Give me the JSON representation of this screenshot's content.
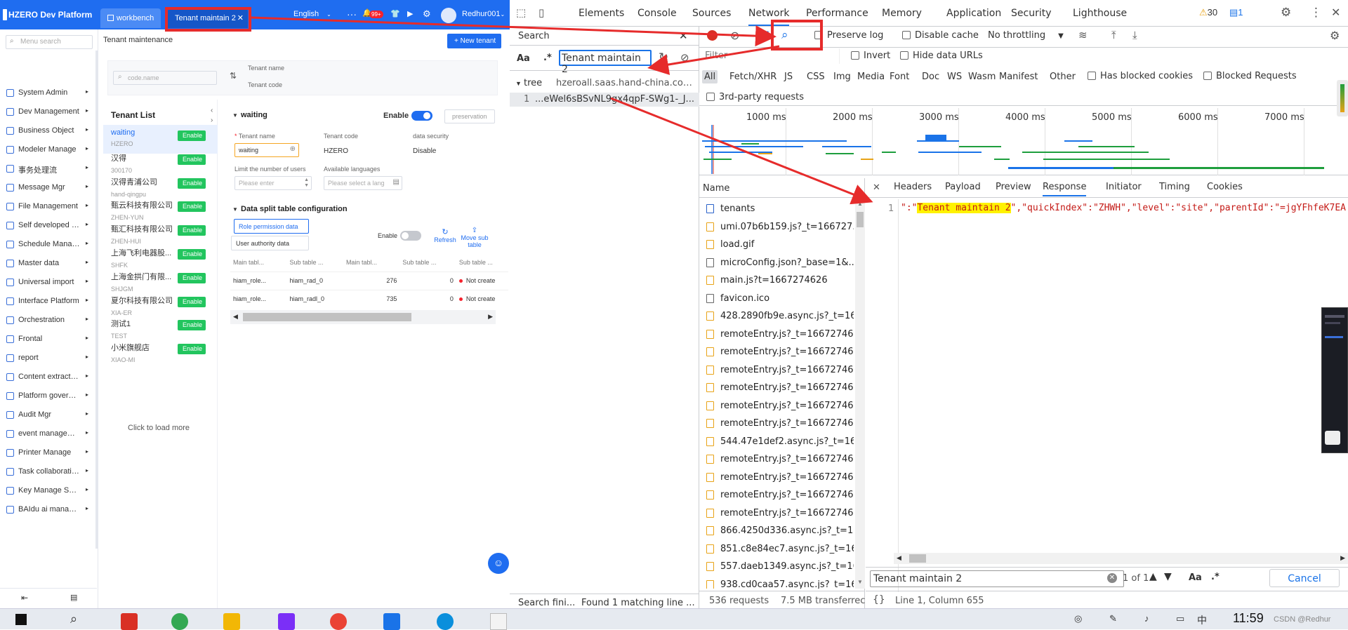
{
  "app": {
    "logo": "HZERO Dev Platform",
    "tabs": [
      {
        "label": "workbench"
      },
      {
        "label": "Tenant maintain 2"
      }
    ],
    "language": "English",
    "more": "···",
    "notif_count": "99+",
    "user": "Redhur001"
  },
  "sidebar": {
    "search_placeholder": "Menu search",
    "items": [
      "System Admin",
      "Dev Management",
      "Business Object",
      "Modeler Manage",
      "事务处理流",
      "Message Mgr",
      "File Management",
      "Self developed w...",
      "Schedule Manag...",
      "Master data",
      "Universal import",
      "Interface Platform",
      "Orchestration",
      "Frontal",
      "report",
      "Content extraction",
      "Platform governa...",
      "Audit Mgr",
      "event manageme...",
      "Printer Manage",
      "Task collaboration",
      "Key Manage Syst...",
      "BAIdu ai manage..."
    ]
  },
  "page": {
    "breadcrumb": "Tenant maintenance",
    "new_button": "+ New tenant",
    "filter": {
      "code_placeholder": "code.name",
      "sort_name": "Tenant name",
      "sort_code": "Tenant code"
    }
  },
  "tenant_list": {
    "title": "Tenant List",
    "items": [
      {
        "name": "waiting",
        "code": "HZERO",
        "status": "Enable"
      },
      {
        "name": "汉得",
        "code": "300170",
        "status": "Enable"
      },
      {
        "name": "汉得青浦公司",
        "code": "hand-qingpu",
        "status": "Enable"
      },
      {
        "name": "甄云科技有限公司",
        "code": "ZHEN-YUN",
        "status": "Enable"
      },
      {
        "name": "甄汇科技有限公司",
        "code": "ZHEN-HUI",
        "status": "Enable"
      },
      {
        "name": "上海飞利电器股...",
        "code": "SHFK",
        "status": "Enable"
      },
      {
        "name": "上海金拱门有限...",
        "code": "SHJGM",
        "status": "Enable"
      },
      {
        "name": "夏尔科技有限公司",
        "code": "XIA-ER",
        "status": "Enable"
      },
      {
        "name": "测试1",
        "code": "TEST",
        "status": "Enable"
      },
      {
        "name": "小米旗舰店",
        "code": "XIAO-MI",
        "status": "Enable"
      }
    ],
    "load_more": "Click to load more"
  },
  "detail": {
    "section_title": "waiting",
    "enable_label": "Enable",
    "preservation": "preservation",
    "labels": {
      "tenant_name": "Tenant name",
      "tenant_code": "Tenant code",
      "data_security": "data security",
      "limit_users": "Limit the number of users",
      "languages": "Available languages"
    },
    "values": {
      "tenant_name": "waiting",
      "tenant_code": "HZERO",
      "data_security": "Disable",
      "limit_placeholder": "Please enter",
      "lang_placeholder": "Please select a lang"
    },
    "split_title": "Data split table configuration",
    "tabs": [
      "Role permission data",
      "User authority data"
    ],
    "table_enable": "Enable",
    "refresh": "Refresh",
    "move_sub": "Move sub table",
    "columns": [
      "Main tabl...",
      "Sub table ...",
      "Main tabl...",
      "Sub table ...",
      "Sub table ..."
    ],
    "rows": [
      [
        "hiam_role...",
        "hiam_rad_0",
        "276",
        "0",
        "Not create"
      ],
      [
        "hiam_role...",
        "hiam_radl_0",
        "735",
        "0",
        "Not create"
      ]
    ]
  },
  "devtools": {
    "tabs": [
      "Elements",
      "Console",
      "Sources",
      "Network",
      "Performance",
      "Memory",
      "Application",
      "Security",
      "Lighthouse"
    ],
    "warnings": "30",
    "issues": "1",
    "search": {
      "title": "Search",
      "aa": "Aa",
      "regex": ".*",
      "query": "Tenant maintain 2",
      "tree_label": "tree",
      "tree_host": "hzeroall.saas.hand-china.com...",
      "result_line": "1",
      "result_text": "...eWel6sBSvNL9gx4qpF-SWg1-_J...",
      "footer_left": "Search fini...",
      "footer_right": "Found 1 matching line ..."
    },
    "toolbar": {
      "preserve_log": "Preserve log",
      "disable_cache": "Disable cache",
      "throttling": "No throttling"
    },
    "filter": {
      "placeholder": "Filter",
      "invert": "Invert",
      "hide_data_urls": "Hide data URLs"
    },
    "types": [
      "All",
      "Fetch/XHR",
      "JS",
      "CSS",
      "Img",
      "Media",
      "Font",
      "Doc",
      "WS",
      "Wasm",
      "Manifest",
      "Other"
    ],
    "blocked_cookies": "Has blocked cookies",
    "blocked_requests": "Blocked Requests",
    "third_party": "3rd-party requests",
    "timeline_ticks": [
      "1000 ms",
      "2000 ms",
      "3000 ms",
      "4000 ms",
      "5000 ms",
      "6000 ms",
      "7000 ms"
    ],
    "name_header": "Name",
    "requests": [
      {
        "name": "tenants",
        "kind": "doc"
      },
      {
        "name": "umi.07b6b159.js?_t=166727...",
        "kind": "js"
      },
      {
        "name": "load.gif",
        "kind": "img"
      },
      {
        "name": "microConfig.json?_base=1&...",
        "kind": "plain"
      },
      {
        "name": "main.js?t=1667274626",
        "kind": "js"
      },
      {
        "name": "favicon.ico",
        "kind": "plain"
      },
      {
        "name": "428.2890fb9e.async.js?_t=16...",
        "kind": "js"
      },
      {
        "name": "remoteEntry.js?_t=16672746...",
        "kind": "js"
      },
      {
        "name": "remoteEntry.js?_t=16672746...",
        "kind": "js"
      },
      {
        "name": "remoteEntry.js?_t=16672746...",
        "kind": "js"
      },
      {
        "name": "remoteEntry.js?_t=16672746...",
        "kind": "js"
      },
      {
        "name": "remoteEntry.js?_t=16672746...",
        "kind": "js"
      },
      {
        "name": "remoteEntry.js?_t=16672746...",
        "kind": "js"
      },
      {
        "name": "544.47e1def2.async.js?_t=16...",
        "kind": "js"
      },
      {
        "name": "remoteEntry.js?_t=16672746...",
        "kind": "js"
      },
      {
        "name": "remoteEntry.js?_t=16672746...",
        "kind": "js"
      },
      {
        "name": "remoteEntry.js?_t=16672746...",
        "kind": "js"
      },
      {
        "name": "remoteEntry.js?_t=16672746...",
        "kind": "js"
      },
      {
        "name": "866.4250d336.async.js?_t=16...",
        "kind": "js"
      },
      {
        "name": "851.c8e84ec7.async.js?_t=16...",
        "kind": "js"
      },
      {
        "name": "557.daeb1349.async.js?_t=16...",
        "kind": "js"
      },
      {
        "name": "938.cd0caa57.async.js?_t=16...",
        "kind": "js"
      }
    ],
    "detail_tabs": [
      "Headers",
      "Payload",
      "Preview",
      "Response",
      "Initiator",
      "Timing",
      "Cookies"
    ],
    "response": {
      "line_no": "1",
      "pre": "\":\"",
      "highlight": "Tenant maintain 2",
      "post": "\",\"quickIndex\":\"ZHWH\",\"level\":\"site\",\"parentId\":\"=jgYFhfeK7EA"
    },
    "find": {
      "query": "Tenant maintain 2",
      "count": "1 of 1",
      "aa": "Aa",
      "regex": ".*",
      "cancel": "Cancel"
    },
    "status": {
      "requests": "536 requests",
      "transferred": "7.5 MB transferrec",
      "braces": "{}",
      "position": "Line 1, Column 655"
    }
  },
  "taskbar": {
    "time": "11:59",
    "watermark": "CSDN @Redhur",
    "ime": "中"
  },
  "colors": {
    "brand": "#1f6df0",
    "enable_badge": "#22c55e",
    "annotation": "#e62b2b",
    "highlight": "#fff200"
  }
}
